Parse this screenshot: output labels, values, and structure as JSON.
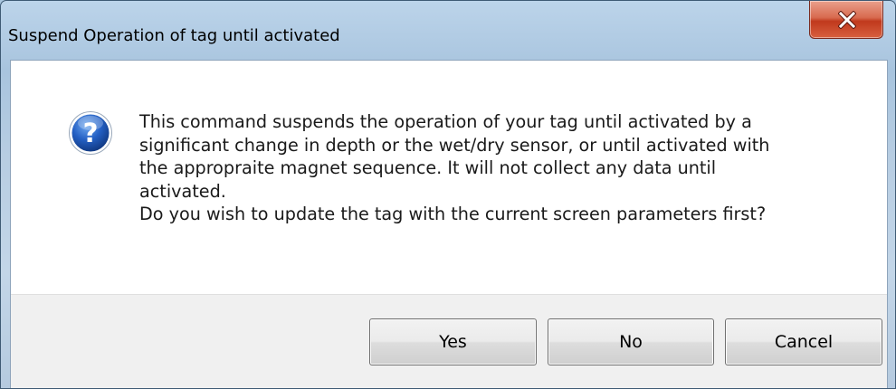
{
  "window": {
    "title": "Suspend Operation of tag until activated",
    "close_icon": "close-x-icon"
  },
  "dialog": {
    "icon": "question-icon",
    "message_lines": [
      "This command suspends the operation of your tag until activated by a",
      "significant change in depth or the wet/dry sensor, or until activated with",
      "the appropraite magnet sequence.  It will not collect any data until",
      "activated.",
      "Do you wish to update the tag with the current screen parameters first?"
    ],
    "buttons": {
      "yes": "Yes",
      "no": "No",
      "cancel": "Cancel"
    }
  },
  "colors": {
    "close_button": "#c7412a",
    "icon_blue": "#1b4fa8"
  }
}
